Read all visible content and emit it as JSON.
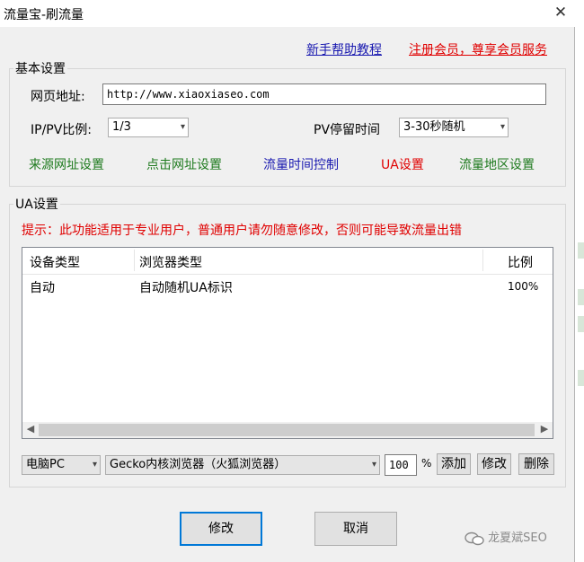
{
  "window": {
    "title": "流量宝-刷流量",
    "close_glyph": "✕"
  },
  "links": {
    "help": "新手帮助教程",
    "register": "注册会员，尊享会员服务"
  },
  "basic": {
    "legend": "基本设置",
    "url_label": "网页地址:",
    "url_value": "http://www.xiaoxiaseo.com",
    "ratio_label": "IP/PV比例:",
    "ratio_value": "1/3",
    "stay_label": "PV停留时间",
    "stay_value": "3-30秒随机",
    "tabs": [
      {
        "label": "来源网址设置",
        "color": "#1e7a1e"
      },
      {
        "label": "点击网址设置",
        "color": "#1e7a1e"
      },
      {
        "label": "流量时间控制",
        "color": "#1a1ab0"
      },
      {
        "label": "UA设置",
        "color": "#e00000"
      },
      {
        "label": "流量地区设置",
        "color": "#1e7a1e"
      }
    ]
  },
  "ua": {
    "legend": "UA设置",
    "warning": "提示：此功能适用于专业用户，普通用户请勿随意修改，否则可能导致流量出错",
    "columns": [
      "设备类型",
      "浏览器类型",
      "比例"
    ],
    "rows": [
      {
        "device": "自动",
        "browser": "自动随机UA标识",
        "ratio": "100%"
      }
    ],
    "device_select": "电脑PC",
    "browser_select": "Gecko内核浏览器（火狐浏览器）",
    "percent_value": "100",
    "percent_sign": "%",
    "add": "添加",
    "edit": "修改",
    "delete": "删除"
  },
  "footer": {
    "ok": "修改",
    "cancel": "取消"
  },
  "watermark": "龙夏斌SEO",
  "icons": {
    "dropdown": "▾",
    "scroll_left": "◀",
    "scroll_right": "▶"
  }
}
